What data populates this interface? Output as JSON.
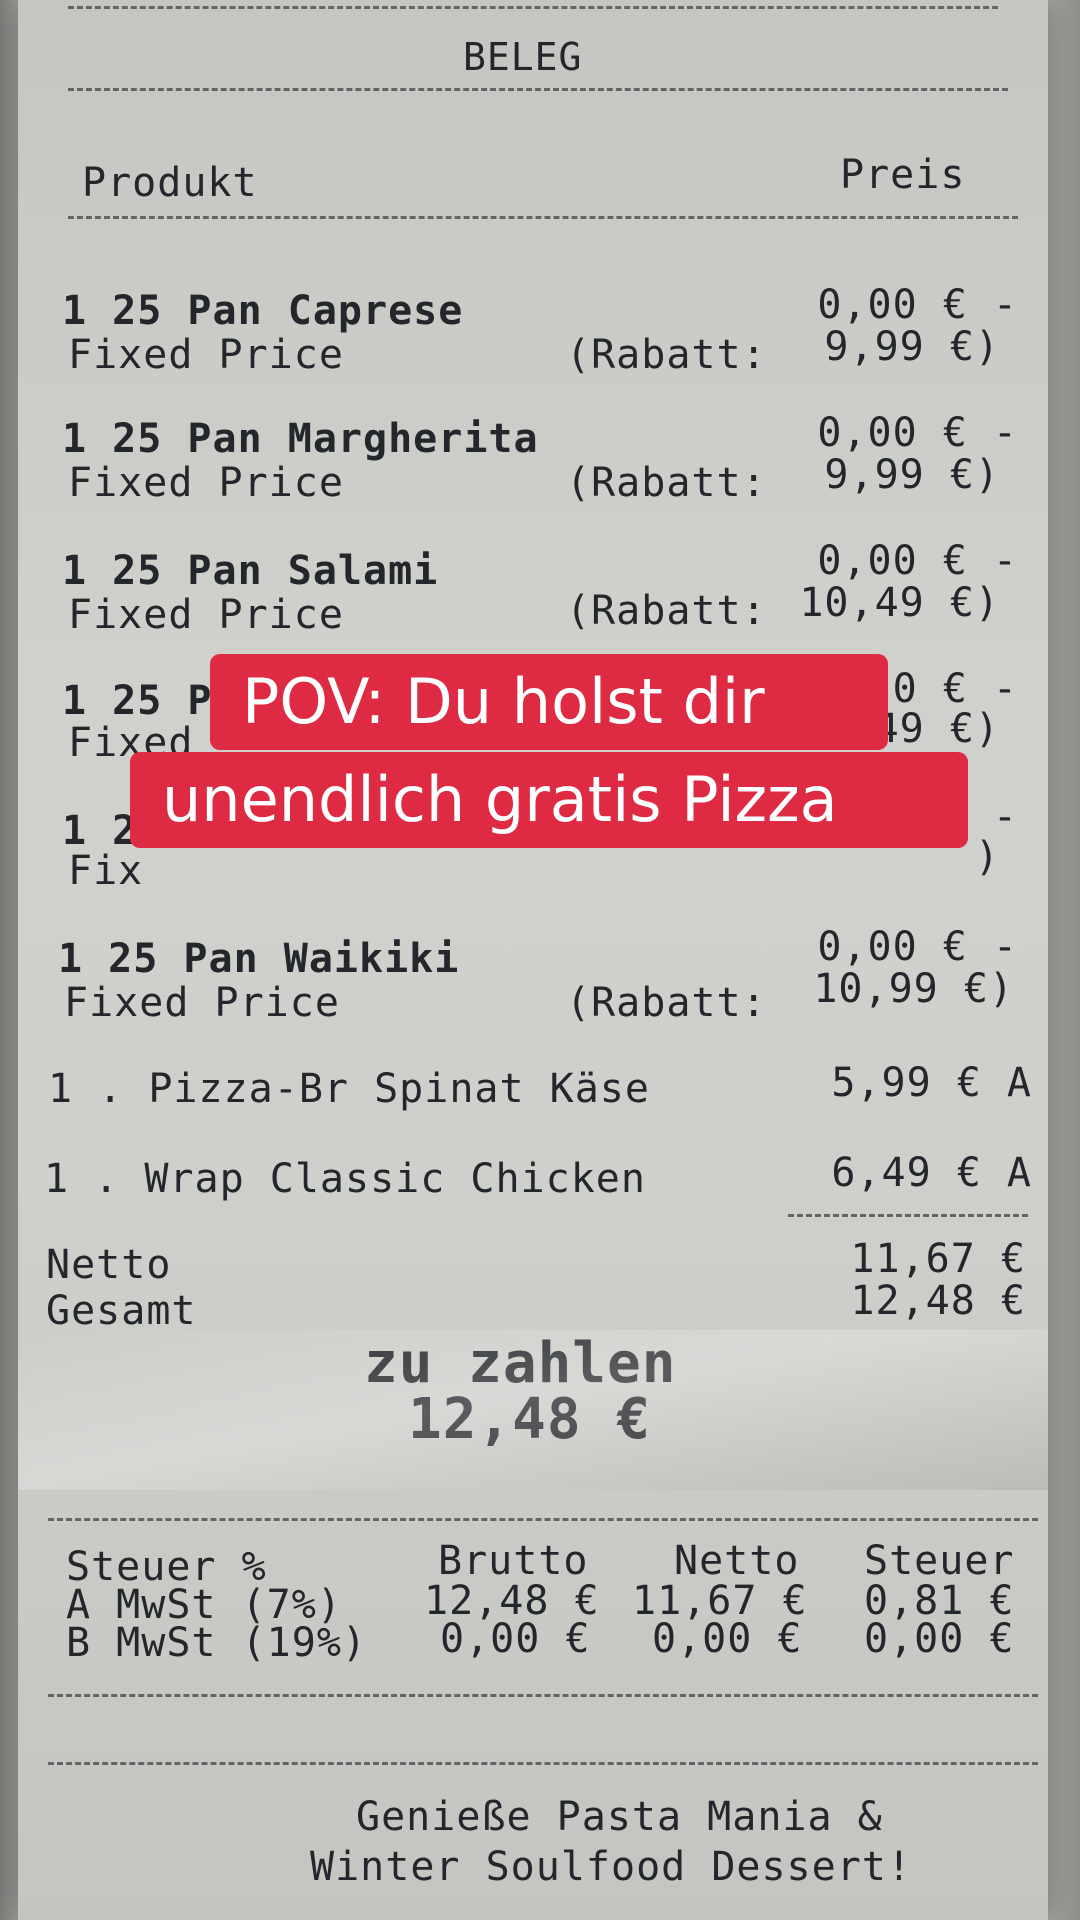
{
  "receipt": {
    "title": "BELEG",
    "header": {
      "product": "Produkt",
      "price": "Preis"
    },
    "items": [
      {
        "line1": "1 25 Pan Caprese",
        "line2": "Fixed Price",
        "rabatt": "(Rabatt:",
        "price1": "0,00 € -",
        "price2": "9,99 €)"
      },
      {
        "line1": "1 25 Pan Margherita",
        "line2": "Fixed Price",
        "rabatt": "(Rabatt:",
        "price1": "0,00 € -",
        "price2": "9,99 €)"
      },
      {
        "line1": "1 25 Pan Salami",
        "line2": "Fixed Price",
        "rabatt": "(Rabatt:",
        "price1": "0,00 € -",
        "price2": "10,49 €)"
      },
      {
        "line1": "1 25 Pa",
        "line2": "Fixed",
        "price1": "0 € -",
        "price2": "49 €)"
      },
      {
        "line1": "1 2",
        "line2": "Fix",
        "price1": "-",
        "price2": ")"
      },
      {
        "line1": "1 25 Pan Waikiki",
        "line2": "Fixed Price",
        "rabatt": "(Rabatt:",
        "price1": "0,00 € -",
        "price2": "10,99 €)"
      }
    ],
    "extras": [
      {
        "label": "1 . Pizza-Br Spinat Käse",
        "price": "5,99 € A"
      },
      {
        "label": "1 . Wrap Classic Chicken",
        "price": "6,49 € A"
      }
    ],
    "netto_label": "Netto",
    "netto_value": "11,67 €",
    "gesamt_label": "Gesamt",
    "gesamt_value": "12,48 €",
    "to_pay_label": "zu zahlen",
    "to_pay_value": "12,48 €",
    "tax": {
      "headers": [
        "Steuer %",
        "Brutto",
        "Netto",
        "Steuer"
      ],
      "rows": [
        [
          "A MwSt (7%)",
          "12,48 €",
          "11,67 €",
          "0,81 €"
        ],
        [
          "B MwSt (19%)",
          "0,00 €",
          "0,00 €",
          "0,00 €"
        ]
      ]
    },
    "footer_line1": "Genieße Pasta Mania &",
    "footer_line2": "Winter Soulfood Dessert!"
  },
  "caption": {
    "line1": "POV: Du holst dir",
    "line2": "unendlich gratis Pizza",
    "background": "#de2b43",
    "text_color": "#ffffff"
  }
}
